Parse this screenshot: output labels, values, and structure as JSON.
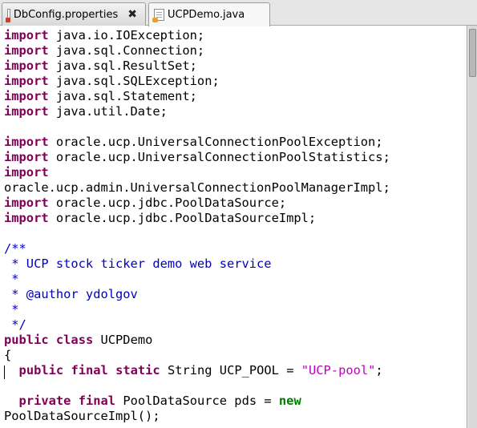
{
  "tabs": [
    {
      "label": "DbConfig.properties",
      "close": "✖",
      "active": false
    },
    {
      "label": "UCPDemo.java",
      "close": "",
      "active": true
    }
  ],
  "code": {
    "lines": [
      [
        {
          "t": "import",
          "c": "kw"
        },
        {
          "t": " java.io.IOException;",
          "c": ""
        }
      ],
      [
        {
          "t": "import",
          "c": "kw"
        },
        {
          "t": " java.sql.Connection;",
          "c": ""
        }
      ],
      [
        {
          "t": "import",
          "c": "kw"
        },
        {
          "t": " java.sql.ResultSet;",
          "c": ""
        }
      ],
      [
        {
          "t": "import",
          "c": "kw"
        },
        {
          "t": " java.sql.SQLException;",
          "c": ""
        }
      ],
      [
        {
          "t": "import",
          "c": "kw"
        },
        {
          "t": " java.sql.Statement;",
          "c": ""
        }
      ],
      [
        {
          "t": "import",
          "c": "kw"
        },
        {
          "t": " java.util.Date;",
          "c": ""
        }
      ],
      [],
      [
        {
          "t": "import",
          "c": "kw"
        },
        {
          "t": " oracle.ucp.UniversalConnectionPoolException;",
          "c": ""
        }
      ],
      [
        {
          "t": "import",
          "c": "kw"
        },
        {
          "t": " oracle.ucp.UniversalConnectionPoolStatistics;",
          "c": ""
        }
      ],
      [
        {
          "t": "import",
          "c": "kw"
        }
      ],
      [
        {
          "t": "oracle.ucp.admin.UniversalConnectionPoolManagerImpl;",
          "c": ""
        }
      ],
      [
        {
          "t": "import",
          "c": "kw"
        },
        {
          "t": " oracle.ucp.jdbc.PoolDataSource;",
          "c": ""
        }
      ],
      [
        {
          "t": "import",
          "c": "kw"
        },
        {
          "t": " oracle.ucp.jdbc.PoolDataSourceImpl;",
          "c": ""
        }
      ],
      [],
      [
        {
          "t": "/**",
          "c": "cm"
        }
      ],
      [
        {
          "t": " * UCP stock ticker demo web service",
          "c": "cm"
        }
      ],
      [
        {
          "t": " *",
          "c": "cm"
        }
      ],
      [
        {
          "t": " * @author ydolgov",
          "c": "cm"
        }
      ],
      [
        {
          "t": " *",
          "c": "cm"
        }
      ],
      [
        {
          "t": " */",
          "c": "cm"
        }
      ],
      [
        {
          "t": "public",
          "c": "kw"
        },
        {
          "t": " ",
          "c": ""
        },
        {
          "t": "class",
          "c": "kw"
        },
        {
          "t": " UCPDemo",
          "c": ""
        }
      ],
      [
        {
          "t": "{",
          "c": ""
        }
      ],
      [
        {
          "t": "  ",
          "c": ""
        },
        {
          "t": "public",
          "c": "kw"
        },
        {
          "t": " ",
          "c": ""
        },
        {
          "t": "final",
          "c": "kw"
        },
        {
          "t": " ",
          "c": ""
        },
        {
          "t": "static",
          "c": "kw"
        },
        {
          "t": " String UCP_POOL = ",
          "c": ""
        },
        {
          "t": "\"UCP-pool\"",
          "c": "str"
        },
        {
          "t": ";",
          "c": ""
        }
      ],
      [],
      [
        {
          "t": "  ",
          "c": ""
        },
        {
          "t": "private",
          "c": "kw"
        },
        {
          "t": " ",
          "c": ""
        },
        {
          "t": "final",
          "c": "kw"
        },
        {
          "t": " PoolDataSource pds = ",
          "c": ""
        },
        {
          "t": "new",
          "c": "nw"
        }
      ],
      [
        {
          "t": "PoolDataSourceImpl();",
          "c": ""
        }
      ]
    ]
  },
  "colors": {
    "keyword": "#7f0055",
    "comment": "#0000c0",
    "string": "#c000c0",
    "new_keyword": "#007a00"
  }
}
